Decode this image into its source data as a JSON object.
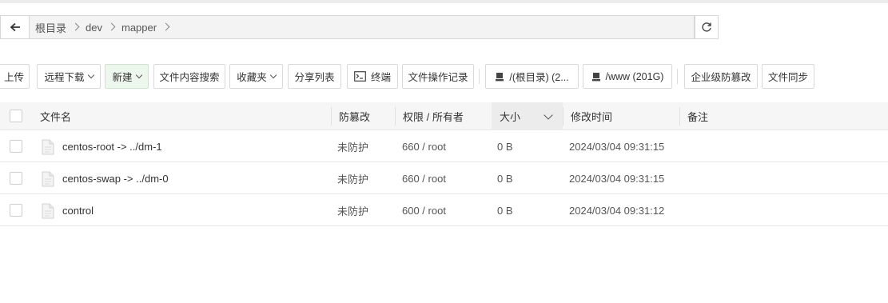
{
  "path": {
    "crumbs": [
      "根目录",
      "dev",
      "mapper"
    ]
  },
  "toolbar": {
    "upload": "上传",
    "remote_download": "远程下载",
    "new": "新建",
    "content_search": "文件内容搜索",
    "favorites": "收藏夹",
    "share_list": "分享列表",
    "terminal": "终端",
    "operation_log": "文件操作记录",
    "disk_root": "/(根目录) (2...",
    "disk_www": "/www (201G)",
    "tamper_proof": "企业级防篡改",
    "file_sync": "文件同步"
  },
  "table": {
    "headers": {
      "name": "文件名",
      "protect": "防篡改",
      "perm": "权限 / 所有者",
      "size": "大小",
      "mtime": "修改时间",
      "note": "备注"
    },
    "rows": [
      {
        "name": "centos-root -> ../dm-1",
        "protect": "未防护",
        "perm": "660 / root",
        "size": "0 B",
        "mtime": "2024/03/04 09:31:15"
      },
      {
        "name": "centos-swap -> ../dm-0",
        "protect": "未防护",
        "perm": "660 / root",
        "size": "0 B",
        "mtime": "2024/03/04 09:31:15"
      },
      {
        "name": "control",
        "protect": "未防护",
        "perm": "600 / root",
        "size": "0 B",
        "mtime": "2024/03/04 09:31:12"
      }
    ]
  },
  "colors": {
    "header_bg": "#f6f6f6",
    "new_button_bg": "#eef7ee"
  }
}
